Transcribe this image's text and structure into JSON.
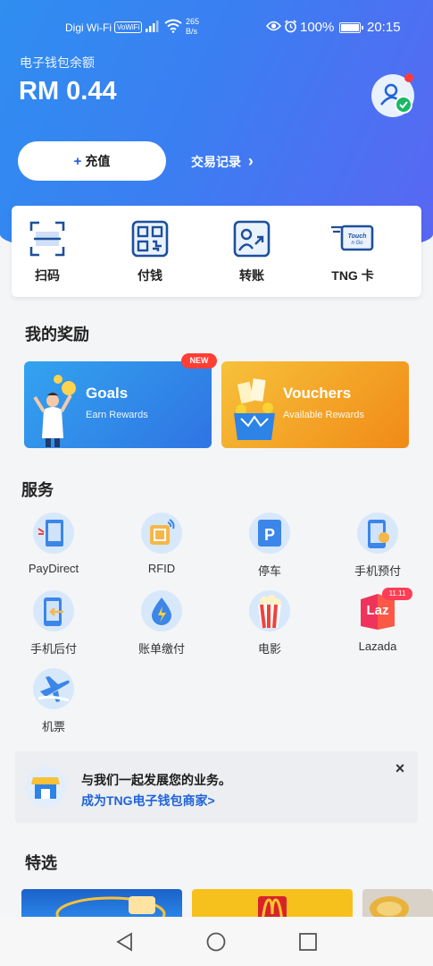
{
  "status_bar": {
    "carrier": "Digi Wi-Fi",
    "volte": "VoWiFi",
    "speed_value": "265",
    "speed_unit": "B/s",
    "battery": "100%",
    "time": "20:15"
  },
  "wallet": {
    "balance_label": "电子钱包余额",
    "balance": "RM 0.44"
  },
  "actions": {
    "topup_plus": "+",
    "topup_label": "充值",
    "history_label": "交易记录",
    "history_arrow": "›"
  },
  "quick_actions": [
    {
      "label": "扫码",
      "icon": "scan-icon"
    },
    {
      "label": "付钱",
      "icon": "qr-pay-icon"
    },
    {
      "label": "转账",
      "icon": "transfer-icon"
    },
    {
      "label": "TNG 卡",
      "icon": "tng-card-icon"
    }
  ],
  "rewards": {
    "title": "我的奖励",
    "new_badge": "NEW",
    "goals": {
      "title": "Goals",
      "subtitle": "Earn Rewards"
    },
    "vouchers": {
      "title": "Vouchers",
      "subtitle": "Available Rewards"
    }
  },
  "services": {
    "title": "服务",
    "items": [
      {
        "label": "PayDirect",
        "icon": "paydirect-icon"
      },
      {
        "label": "RFID",
        "icon": "rfid-icon"
      },
      {
        "label": "停车",
        "icon": "parking-icon"
      },
      {
        "label": "手机预付",
        "icon": "prepaid-mobile-icon"
      },
      {
        "label": "手机后付",
        "icon": "postpaid-mobile-icon"
      },
      {
        "label": "账单缴付",
        "icon": "bill-payment-icon"
      },
      {
        "label": "电影",
        "icon": "movie-icon"
      },
      {
        "label": "Lazada",
        "icon": "lazada-icon"
      },
      {
        "label": "机票",
        "icon": "flight-icon"
      }
    ],
    "lazada_badge": "11.11",
    "lazada_logo": "Laz"
  },
  "merchant_banner": {
    "title": "与我们一起发展您的业务。",
    "link": "成为TNG电子钱包商家>",
    "close": "×"
  },
  "featured": {
    "title": "特选"
  },
  "colors": {
    "header_start": "#2f8ef0",
    "header_end": "#5a66f2",
    "accent_blue": "#1f63d9",
    "goals_card": "#33a3ef",
    "vouchers_card": "#f08a16",
    "badge_red": "#ff3e35"
  }
}
